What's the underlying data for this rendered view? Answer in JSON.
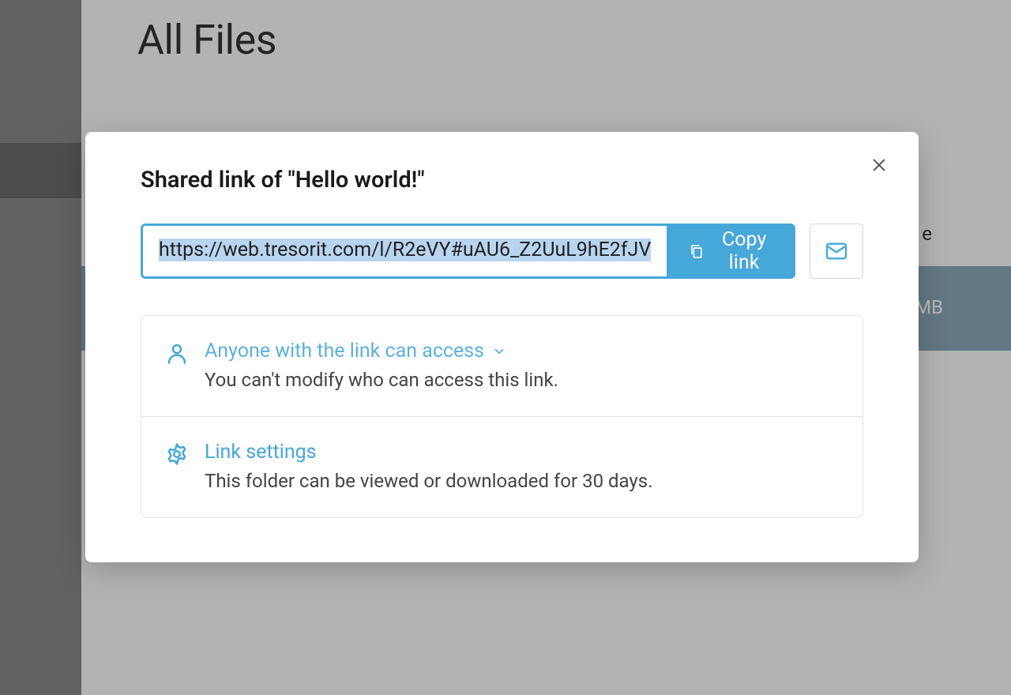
{
  "background": {
    "page_title": "All Files",
    "column_header_fragment": "e",
    "row_size_fragment": "MB"
  },
  "modal": {
    "title": "Shared link of \"Hello world!\"",
    "link_url": "https://web.tresorit.com/l/R2eVY#uAU6_Z2UuL9hE2fJV",
    "copy_button_label": "Copy link",
    "access_section": {
      "heading": "Anyone with the link can access",
      "description": "You can't modify who can access this link."
    },
    "settings_section": {
      "heading": "Link settings",
      "description": "This folder can be viewed or downloaded for 30 days."
    }
  }
}
